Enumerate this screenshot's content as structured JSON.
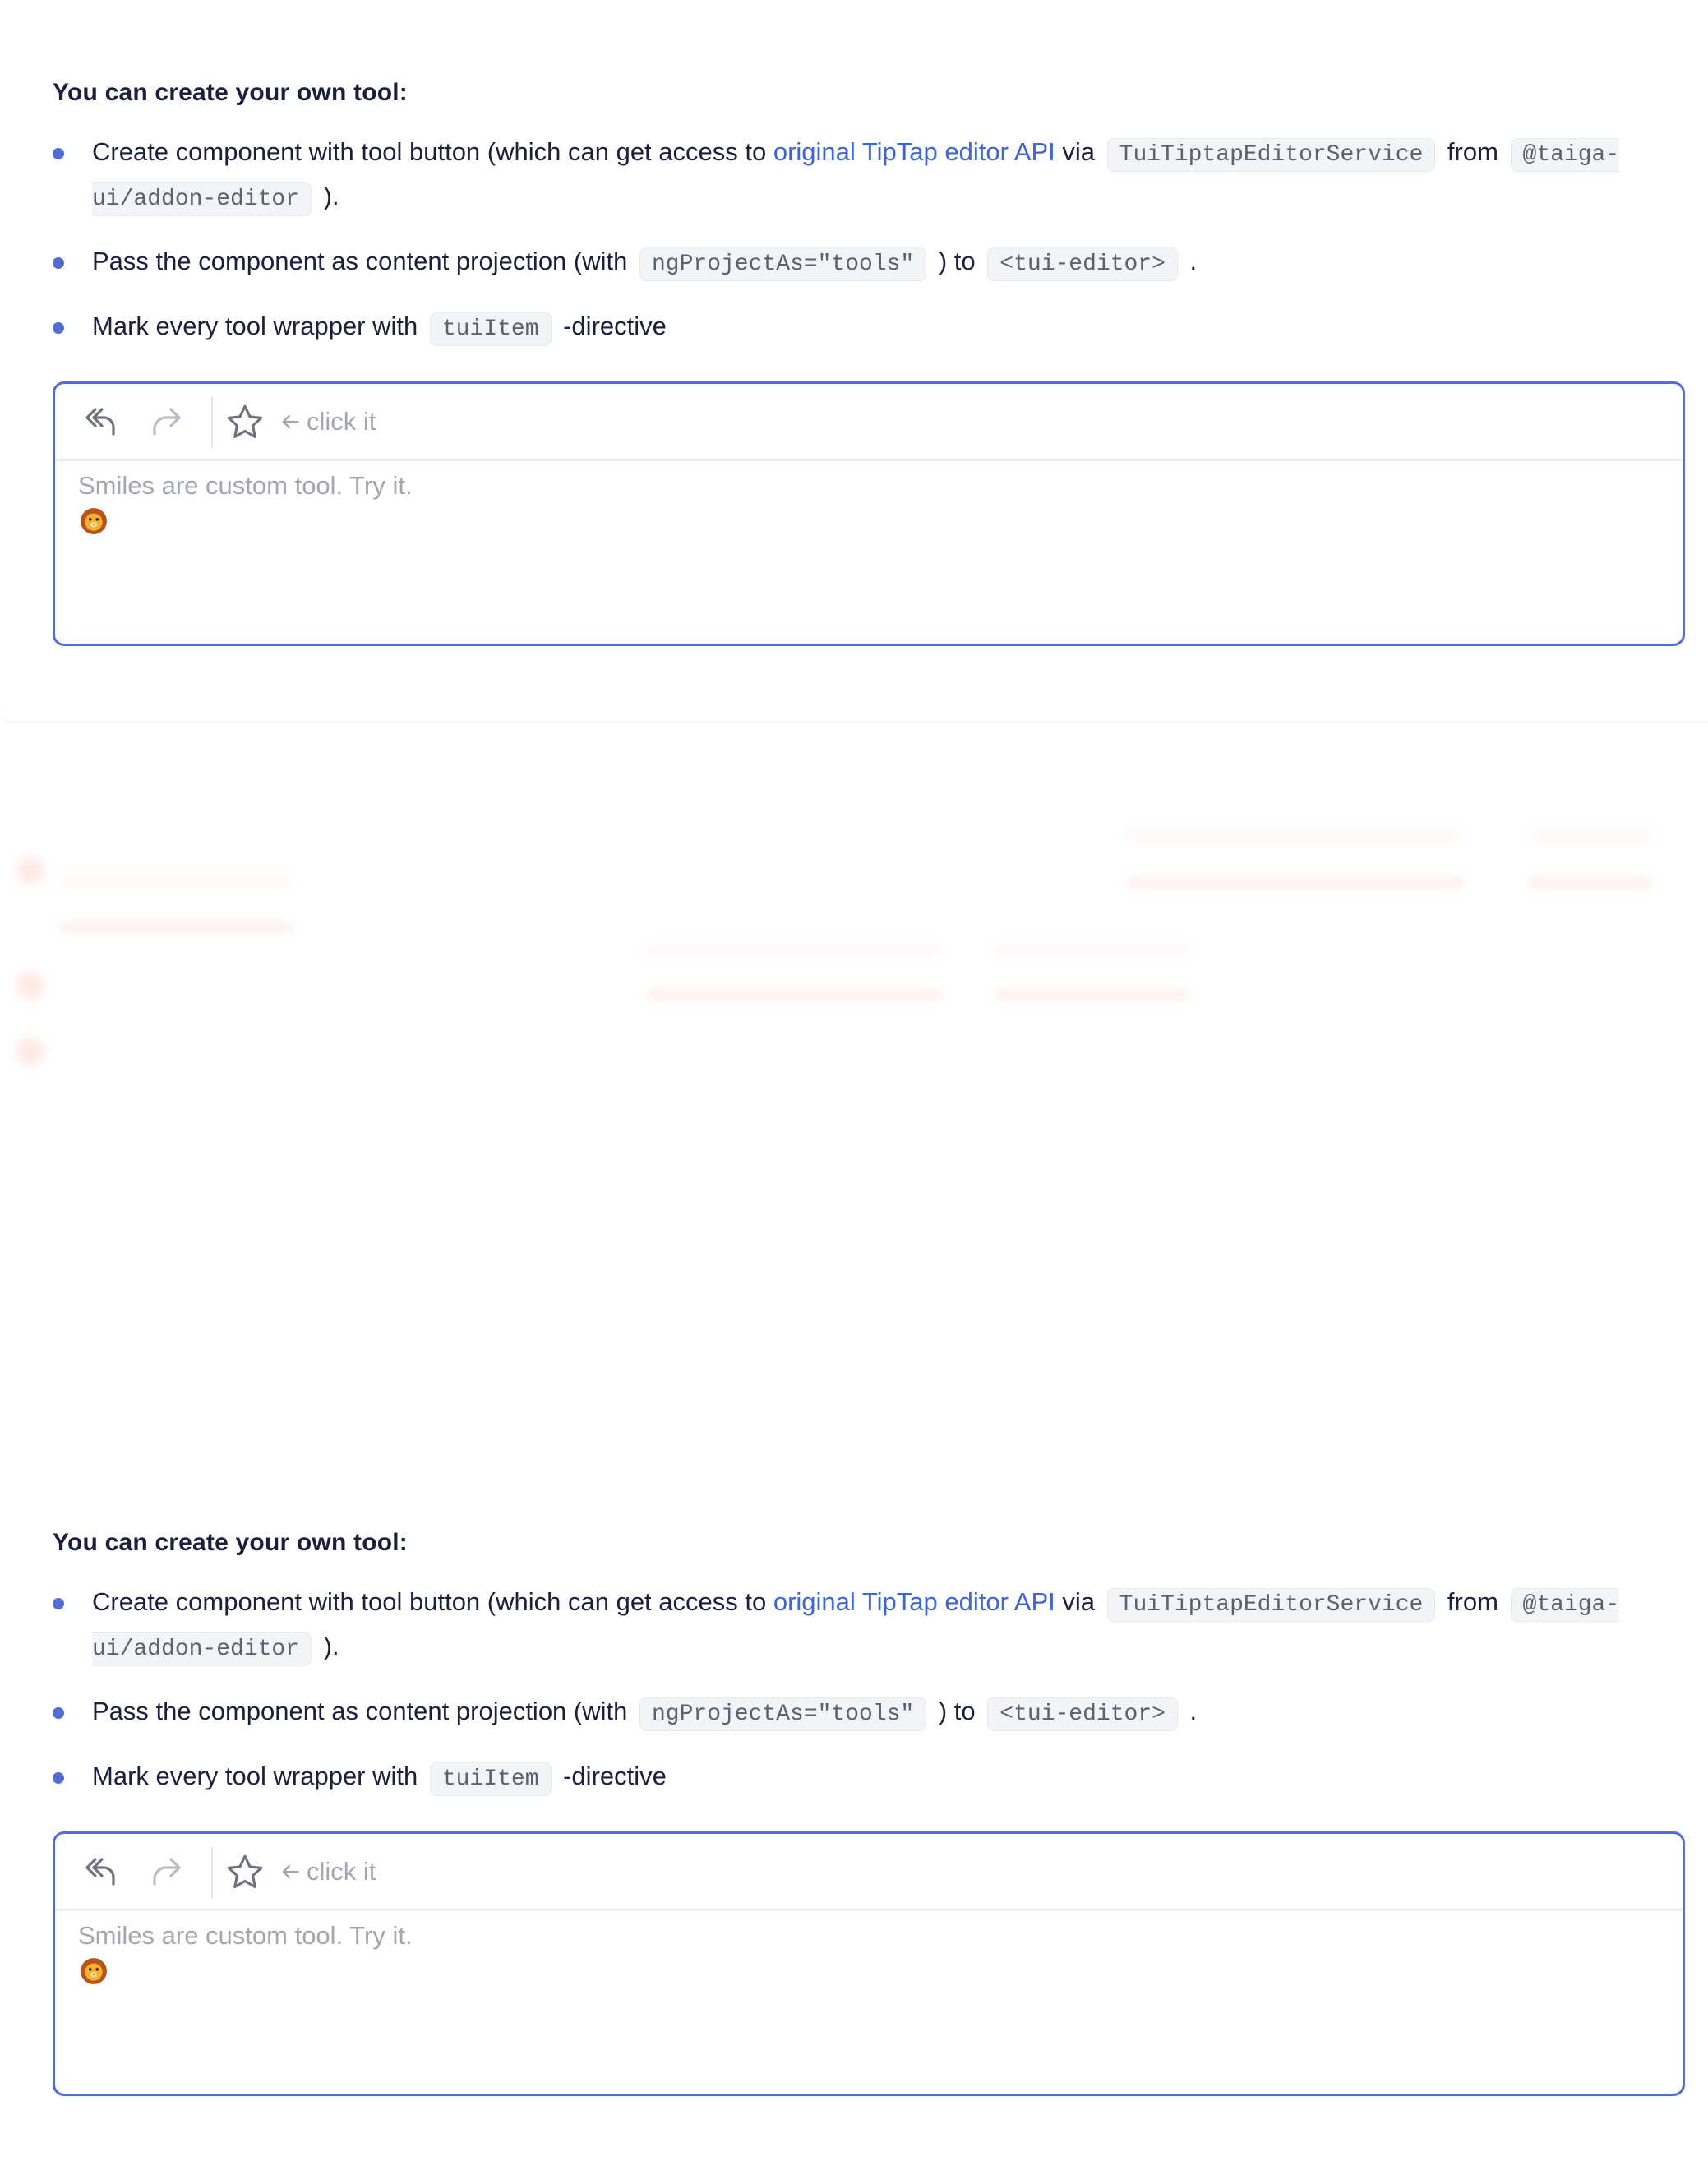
{
  "sections": [
    {
      "heading": "You can create your own tool:",
      "b1": {
        "pre": "Create component with tool button (which can get access to ",
        "link": "original TipTap editor API",
        "via": " via ",
        "code1": "TuiTiptapEditorService",
        "from": " from ",
        "code2": "@taiga-ui/addon-editor",
        "end": " )."
      },
      "b2": {
        "pre": "Pass the component as content projection (with ",
        "code1": "ngProjectAs=\"tools\"",
        "mid": " ) to ",
        "code2": "<tui-editor>",
        "end": " ."
      },
      "b3": {
        "pre": "Mark every tool wrapper with ",
        "code1": "tuiItem",
        "end": " -directive"
      },
      "editor": {
        "hint": "click it",
        "content": "Smiles are custom tool. Try it.",
        "emoji": "🦁",
        "icons": [
          "undo-icon",
          "redo-icon",
          "star-icon",
          "arrow-left-icon"
        ]
      }
    },
    {
      "heading": "You can create your own tool:",
      "b1": {
        "pre": "Create component with tool button (which can get access to ",
        "link": "original TipTap editor API",
        "via": " via ",
        "code1": "TuiTiptapEditorService",
        "from": " from ",
        "code2": "@taiga-ui/addon-editor",
        "end": " )."
      },
      "b2": {
        "pre": "Pass the component as content projection (with ",
        "code1": "ngProjectAs=\"tools\"",
        "mid": " ) to ",
        "code2": "<tui-editor>",
        "end": " ."
      },
      "b3": {
        "pre": "Mark every tool wrapper with ",
        "code1": "tuiItem",
        "end": " -directive"
      },
      "editor": {
        "hint": "click it",
        "content": "Smiles are custom tool. Try it.",
        "emoji": "🦁",
        "icons": [
          "undo-icon",
          "redo-icon",
          "star-icon",
          "arrow-left-icon"
        ]
      }
    }
  ],
  "colors": {
    "accent": "#526ed3",
    "link": "#3e64d6",
    "muted": "#a3a6b2",
    "text": "#1b1f3b"
  }
}
